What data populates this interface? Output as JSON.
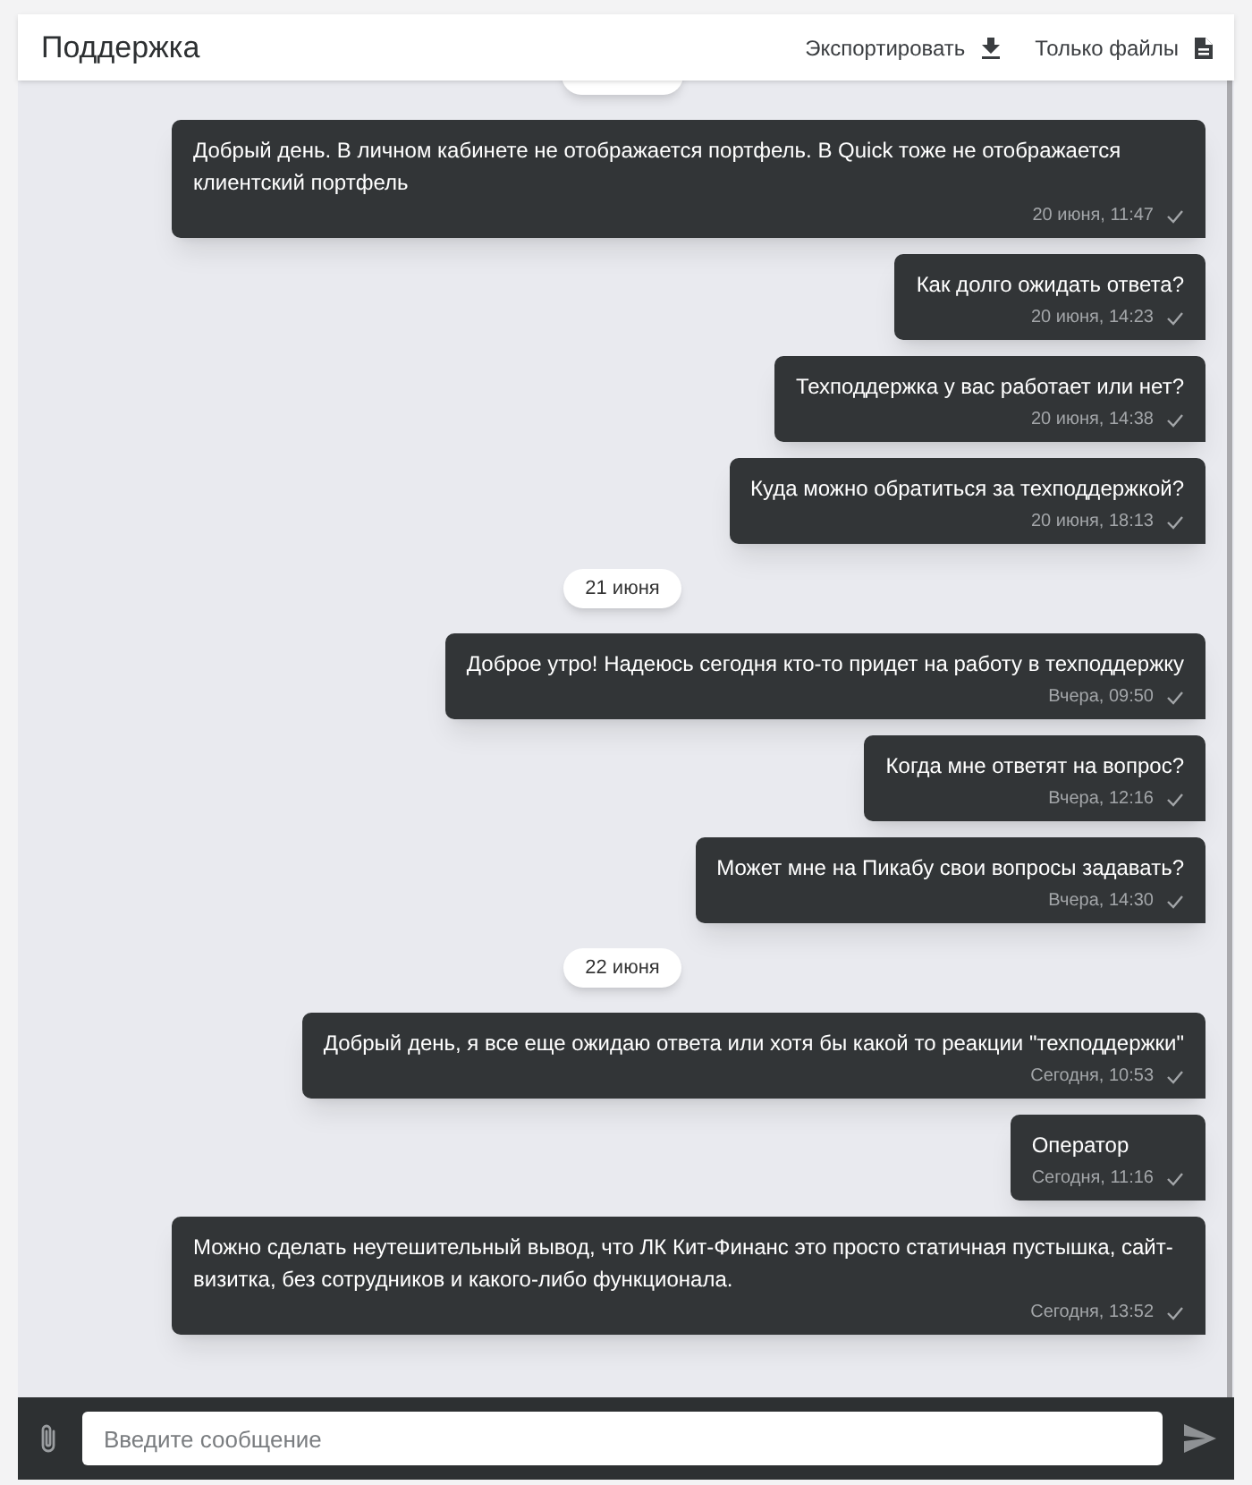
{
  "header": {
    "title": "Поддержка",
    "actions": [
      {
        "label": "Экспортировать",
        "kind": "download"
      },
      {
        "label": "Только файлы",
        "kind": "file"
      }
    ]
  },
  "messages": [
    {
      "kind": "message",
      "text": "Добрый день. В личном кабинете не отображается портфель. В Quick тоже не отображается клиентский портфель",
      "time": "20 июня, 11:47"
    },
    {
      "kind": "message",
      "text": "Как долго ожидать ответа?",
      "time": "20 июня, 14:23"
    },
    {
      "kind": "message",
      "text": "Техподдержка у вас работает или нет?",
      "time": "20 июня, 14:38"
    },
    {
      "kind": "message",
      "text": "Куда можно обратиться за техподдержкой?",
      "time": "20 июня, 18:13"
    },
    {
      "kind": "date",
      "text": "21 июня"
    },
    {
      "kind": "message",
      "text": "Доброе утро! Надеюсь сегодня кто-то придет на работу в техподдержку",
      "time": "Вчера, 09:50"
    },
    {
      "kind": "message",
      "text": "Когда мне ответят на вопрос?",
      "time": "Вчера, 12:16"
    },
    {
      "kind": "message",
      "text": "Может мне на Пикабу свои вопросы задавать?",
      "time": "Вчера, 14:30"
    },
    {
      "kind": "date",
      "text": "22 июня"
    },
    {
      "kind": "message",
      "text": "Добрый день, я все еще ожидаю ответа или хотя бы какой то реакции \"техподдержки\"",
      "time": "Сегодня, 10:53"
    },
    {
      "kind": "message",
      "text": "Оператор",
      "time": "Сегодня, 11:16"
    },
    {
      "kind": "message",
      "text": "Можно сделать неутешительный вывод, что ЛК Кит-Финанс это просто статичная пустышка, сайт-визитка, без сотрудников и какого-либо функционала.",
      "time": "Сегодня, 13:52"
    }
  ],
  "composer": {
    "placeholder": "Введите сообщение"
  }
}
